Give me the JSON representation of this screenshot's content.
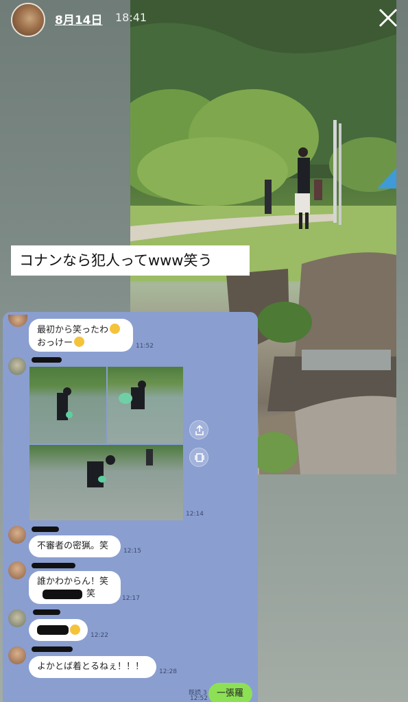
{
  "story": {
    "date": "8月14日",
    "time": "18:41"
  },
  "caption": "コナンなら犯人ってwww笑う",
  "chat": {
    "messages": [
      {
        "line1": "最初から笑ったわ",
        "line2": "おっけー",
        "time": "11:52"
      },
      {
        "type": "photos",
        "time": "12:14"
      },
      {
        "text": "不審者の密猟。笑",
        "time": "12:15"
      },
      {
        "line1": "誰かわからん！笑",
        "line2": "笑",
        "time": "12:17"
      },
      {
        "time": "12:22"
      },
      {
        "text": "よかとば着とるねぇ！！！",
        "time": "12:28"
      }
    ],
    "outgoing": {
      "text": "一張羅",
      "read": "既読 3",
      "time": "12:52"
    }
  },
  "colors": {
    "chat_bg": "#8a9ed0",
    "outgoing_bubble": "#8de055",
    "caption_bg": "#ffffff"
  },
  "icons": [
    "close-icon",
    "share-icon",
    "copy-icon"
  ]
}
